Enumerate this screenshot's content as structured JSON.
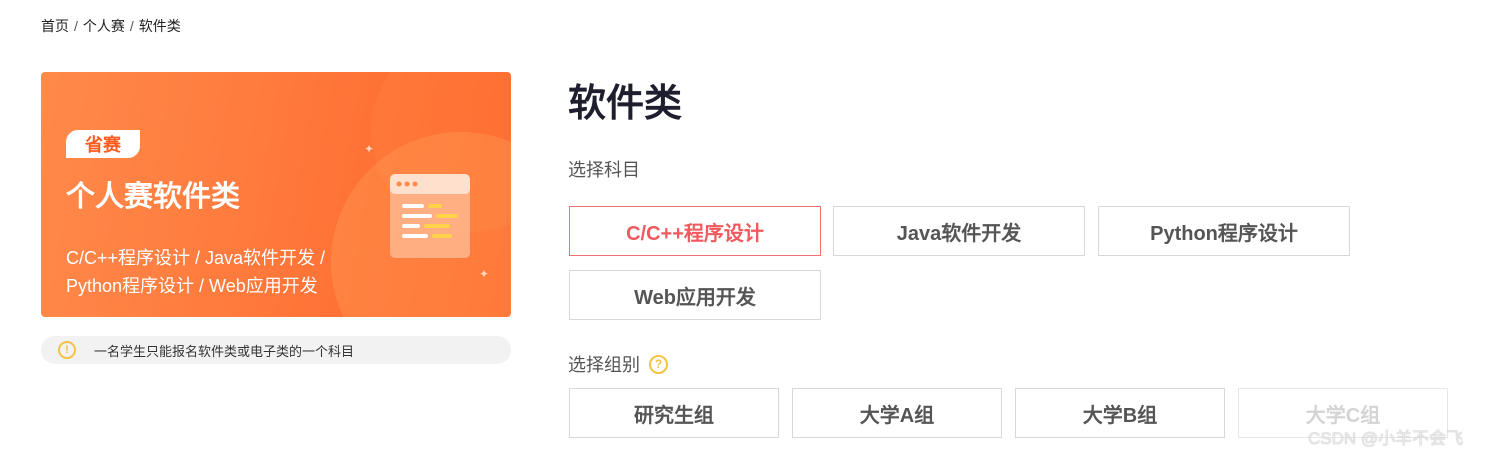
{
  "breadcrumb": {
    "home": "首页",
    "category": "个人赛",
    "current": "软件类",
    "separator": "/"
  },
  "banner": {
    "badge": "省赛",
    "title": "个人赛软件类",
    "desc_line1": "C/C++程序设计 / Java软件开发 /",
    "desc_line2": "Python程序设计 / Web应用开发",
    "illustration_icon": "code-window-icon"
  },
  "notice": {
    "icon": "warning-icon",
    "text": "一名学生只能报名软件类或电子类的一个科目"
  },
  "main": {
    "title": "软件类",
    "subject_label": "选择科目",
    "subjects": [
      {
        "label": "C/C++程序设计",
        "state": "selected"
      },
      {
        "label": "Java软件开发",
        "state": "normal"
      },
      {
        "label": "Python程序设计",
        "state": "normal"
      },
      {
        "label": "Web应用开发",
        "state": "normal"
      }
    ],
    "group_label": "选择组别",
    "group_help_icon": "question-circle-icon",
    "groups": [
      {
        "label": "研究生组",
        "state": "normal"
      },
      {
        "label": "大学A组",
        "state": "normal"
      },
      {
        "label": "大学B组",
        "state": "normal"
      },
      {
        "label": "大学C组",
        "state": "disabled"
      }
    ]
  },
  "watermark": "CSDN @小羊不会飞",
  "colors": {
    "accent": "#f0595e",
    "banner": "#ff7a3d",
    "warning": "#f5c244"
  }
}
